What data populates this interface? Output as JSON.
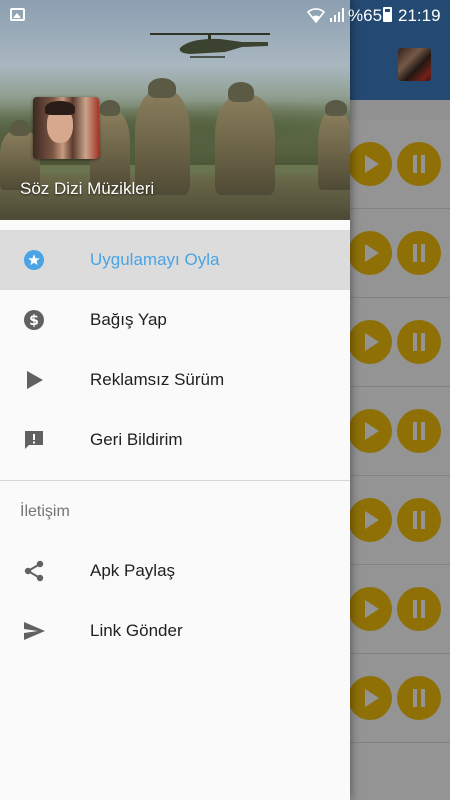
{
  "status_bar": {
    "battery_percent": "%65",
    "time": "21:19"
  },
  "drawer": {
    "header_title": "Söz Dizi Müzikleri",
    "menu_items": [
      {
        "label": "Uygulamayı Oyla",
        "icon": "star-circle-icon",
        "active": true
      },
      {
        "label": "Bağış Yap",
        "icon": "dollar-circle-icon",
        "active": false
      },
      {
        "label": "Reklamsız Sürüm",
        "icon": "play-icon",
        "active": false
      },
      {
        "label": "Geri Bildirim",
        "icon": "feedback-icon",
        "active": false
      }
    ],
    "section_title": "İletişim",
    "contact_items": [
      {
        "label": "Apk Paylaş",
        "icon": "share-icon"
      },
      {
        "label": "Link Gönder",
        "icon": "send-icon"
      }
    ]
  },
  "colors": {
    "app_bar": "#3f7fc4",
    "accent": "#4aa3e4",
    "player_button": "#f4c20d"
  }
}
